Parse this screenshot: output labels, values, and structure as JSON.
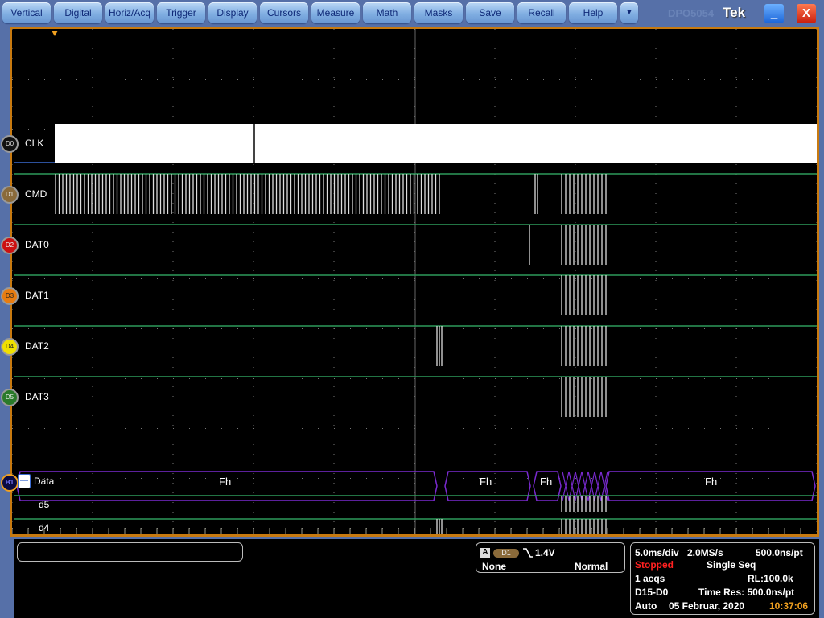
{
  "menu": {
    "items": [
      "Vertical",
      "Digital",
      "Horiz/Acq",
      "Trigger",
      "Display",
      "Cursors",
      "Measure",
      "Math",
      "Masks",
      "Save",
      "Recall",
      "Help"
    ],
    "more_icon": "▼",
    "model_ghost": "DPO5054",
    "brand": "Tek",
    "minimize_icon": "_",
    "close_icon": "X"
  },
  "channels": [
    {
      "id": "D0",
      "label": "CLK",
      "color": "#111111",
      "text_color": "#dddddd"
    },
    {
      "id": "D1",
      "label": "CMD",
      "color": "#8a6a3a",
      "text_color": "#eeeeee"
    },
    {
      "id": "D2",
      "label": "DAT0",
      "color": "#cc1010",
      "text_color": "#eeeeee"
    },
    {
      "id": "D3",
      "label": "DAT1",
      "color": "#e87c10",
      "text_color": "#222222"
    },
    {
      "id": "D4",
      "label": "DAT2",
      "color": "#f0e000",
      "text_color": "#222222"
    },
    {
      "id": "D5",
      "label": "DAT3",
      "color": "#2a7a2a",
      "text_color": "#eeeeee"
    }
  ],
  "bus": {
    "id": "B1",
    "label": "Data",
    "collapse_icon": "—",
    "values": [
      "Fh",
      "Fh",
      "Fh",
      "Fh"
    ],
    "bits": [
      "d5",
      "d4"
    ]
  },
  "trigger": {
    "source_box": "A",
    "source": "D1",
    "slope_icon": "falling-edge",
    "level": "1.4V",
    "coupling": "None",
    "mode": "Normal"
  },
  "acquisition": {
    "timebase": "5.0ms/div",
    "sample_rate": "2.0MS/s",
    "resolution": "500.0ns/pt",
    "status": "Stopped",
    "mode": "Single Seq",
    "acqs": "1 acqs",
    "record_length": "RL:100.0k",
    "channels": "D15-D0",
    "time_res": "Time Res: 500.0ns/pt",
    "trigger_mode": "Auto",
    "date": "05 Februar, 2020",
    "time": "10:37:06"
  },
  "colors": {
    "status_stopped": "#ff2020",
    "time": "#f0a020",
    "digital_trace": "#2e9a5a",
    "bus": "#7a2ad0",
    "frame": "#c87a10"
  }
}
